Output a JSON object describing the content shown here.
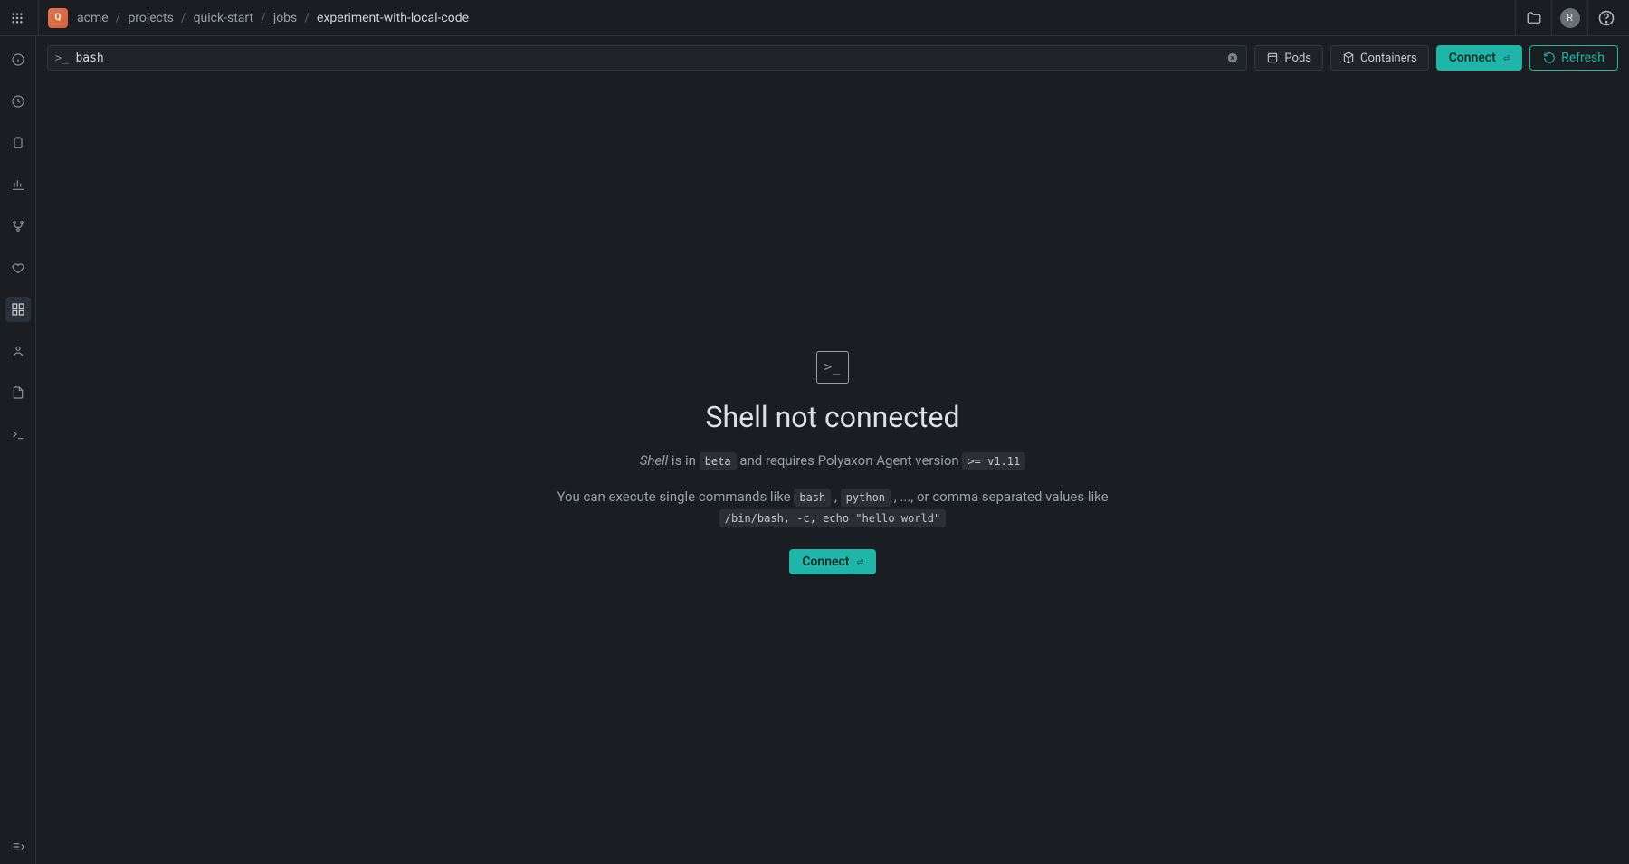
{
  "logo_letter": "Q",
  "breadcrumb": [
    "acme",
    "projects",
    "quick-start",
    "jobs",
    "experiment-with-local-code"
  ],
  "avatar_letter": "R",
  "toolbar": {
    "prompt": ">_",
    "command_value": "bash",
    "pods_label": "Pods",
    "containers_label": "Containers",
    "connect_label": "Connect",
    "connect_kbd": "⏎",
    "refresh_label": "Refresh"
  },
  "empty_state": {
    "title": "Shell not connected",
    "shell_word": "Shell",
    "shell_is_in": " is in ",
    "beta_tag": "beta",
    "requires_text": " and requires Polyaxon Agent version ",
    "version_tag": ">= v1.11",
    "line2_a": "You can execute single commands like ",
    "code_bash": "bash",
    "comma1": " , ",
    "code_python": "python",
    "line2_b": " , ..., or comma separated values like ",
    "code_example": "/bin/bash, -c, echo \"hello world\"",
    "connect_label": "Connect",
    "connect_kbd": "⏎"
  }
}
